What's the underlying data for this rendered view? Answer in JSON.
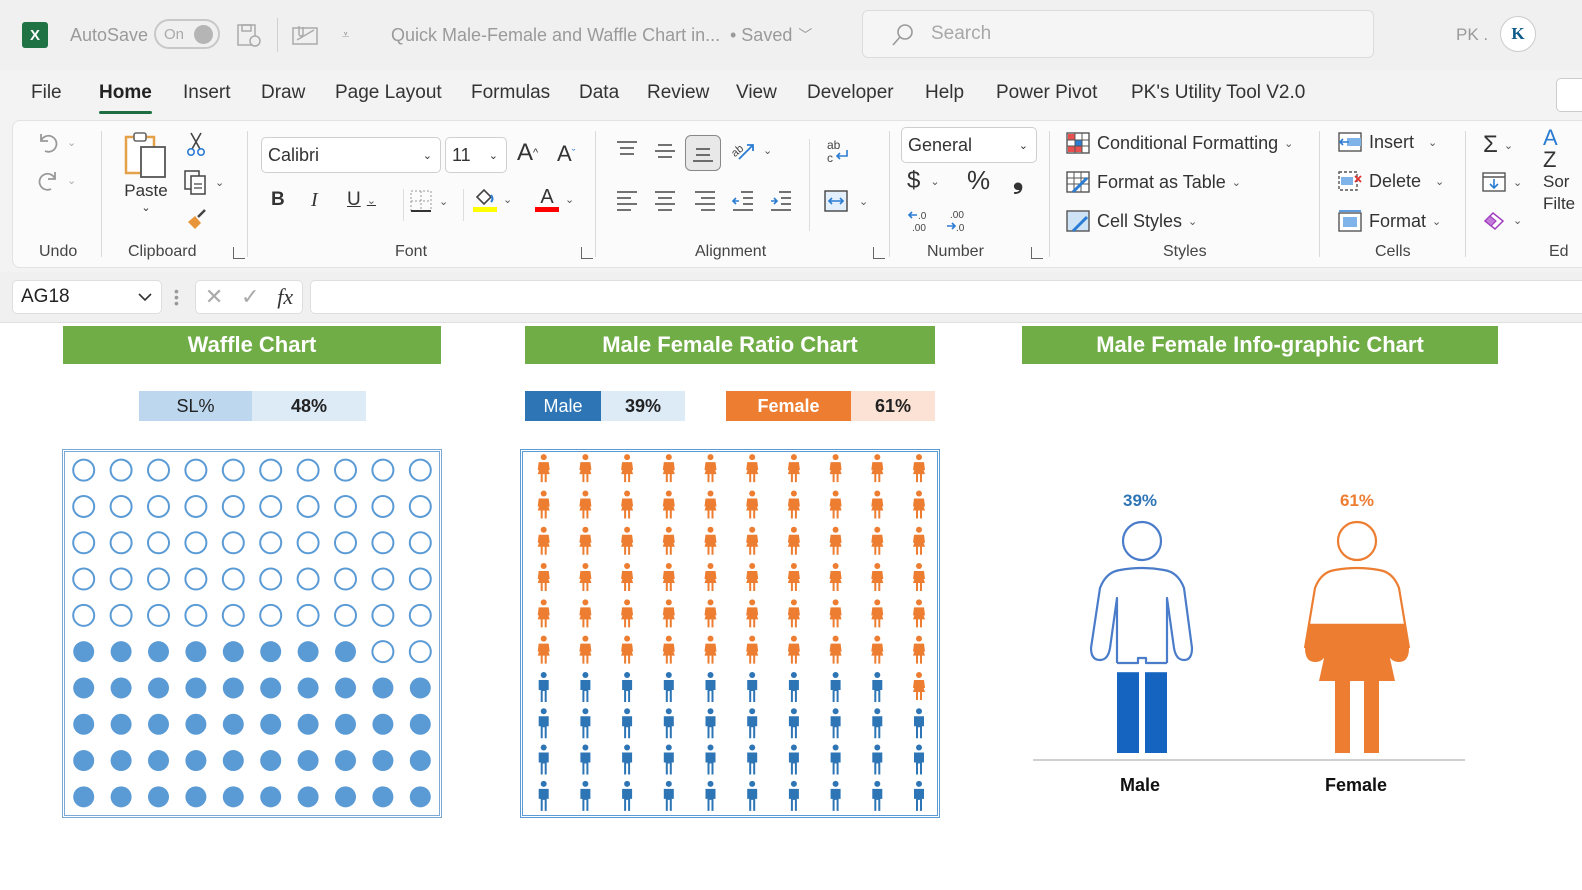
{
  "titlebar": {
    "autosave_label": "AutoSave",
    "autosave_state": "On",
    "doc_title": "Quick Male-Female and Waffle Chart in...",
    "save_status": "• Saved",
    "search_placeholder": "Search",
    "user_initials": "PK .",
    "avatar_text": "K"
  },
  "menu": {
    "items": [
      "File",
      "Home",
      "Insert",
      "Draw",
      "Page Layout",
      "Formulas",
      "Data",
      "Review",
      "View",
      "Developer",
      "Help",
      "Power Pivot",
      "PK's Utility Tool V2.0"
    ],
    "active": "Home"
  },
  "ribbon": {
    "groups": {
      "undo": "Undo",
      "clipboard": "Clipboard",
      "font": "Font",
      "alignment": "Alignment",
      "number": "Number",
      "styles": "Styles",
      "cells": "Cells",
      "editing": "Ed"
    },
    "paste_label": "Paste",
    "font_name": "Calibri",
    "font_size": "11",
    "number_format": "General",
    "bold": "B",
    "italic": "I",
    "underline": "U",
    "currency": "$",
    "percent": "%",
    "comma": "9",
    "styles_buttons": [
      "Conditional Formatting",
      "Format as Table",
      "Cell Styles"
    ],
    "cells_buttons": [
      "Insert",
      "Delete",
      "Format"
    ],
    "editing_sort_label": "Sor",
    "editing_filter_label": "Filte",
    "colors": {
      "fill_highlight": "#ffff00",
      "font_color": "#ff0000"
    }
  },
  "formula_bar": {
    "name_box": "AG18",
    "fx_label": "fx",
    "formula": ""
  },
  "sheet": {
    "waffle": {
      "title": "Waffle Chart",
      "label": "SL%",
      "value_text": "48%"
    },
    "ratio": {
      "title": "Male Female Ratio Chart",
      "male_label": "Male",
      "male_value_text": "39%",
      "female_label": "Female",
      "female_value_text": "61%"
    },
    "info": {
      "title": "Male Female Info-graphic Chart",
      "male_pct_text": "39%",
      "female_pct_text": "61%",
      "male_label": "Male",
      "female_label": "Female"
    }
  },
  "chart_data": [
    {
      "type": "waffle",
      "title": "Waffle Chart",
      "grid": [
        10,
        10
      ],
      "filled_count": 48,
      "total": 100,
      "fill_order": "bottom-up, left-to-right",
      "colors": {
        "filled": "#5b9bd5",
        "empty_outline": "#5b9bd5"
      }
    },
    {
      "type": "pictograph",
      "title": "Male Female Ratio Chart",
      "grid": [
        10,
        10
      ],
      "categories": [
        "Male",
        "Female"
      ],
      "values": [
        39,
        61
      ],
      "fill_order": "male bottom-up, left-to-right",
      "colors": {
        "Male": "#2e75b6",
        "Female": "#ed7d31"
      }
    },
    {
      "type": "infographic",
      "title": "Male Female Info-graphic Chart",
      "categories": [
        "Male",
        "Female"
      ],
      "values": [
        39,
        61
      ],
      "colors": {
        "Male": "#1565c0",
        "Female": "#ed7d31"
      }
    }
  ]
}
